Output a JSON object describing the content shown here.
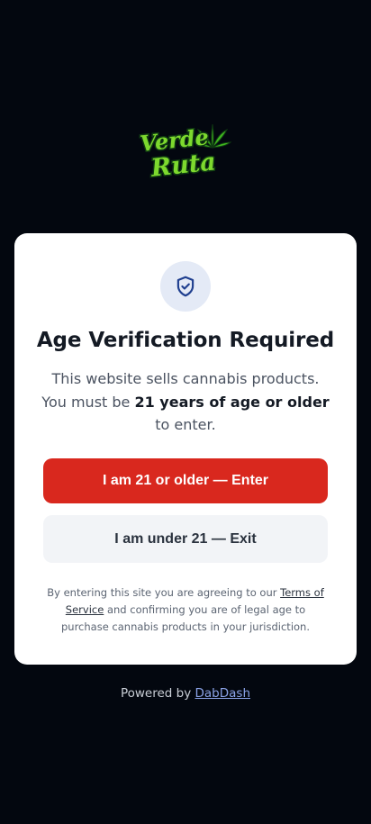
{
  "logo": {
    "line1": "Verde",
    "line2": "Ruta",
    "colors": {
      "leaf": "#3fb51f",
      "text_fill": "#7dd92e",
      "outline": "#0f3a12"
    }
  },
  "card": {
    "icon": "shield-check-icon",
    "title": "Age Verification Required",
    "description_before": "This website sells cannabis products. You must be ",
    "description_bold": "21 years of age or older",
    "description_after": " to enter.",
    "enter_button_label": "I am 21 or older — Enter",
    "exit_button_label": "I am under 21 — Exit",
    "fine_print_before": "By entering this site you are agreeing to our ",
    "fine_print_link": "Terms of Service",
    "fine_print_after": " and confirming you are of legal age to purchase cannabis products in your jurisdiction."
  },
  "footer": {
    "powered_by": "Powered by ",
    "brand_link": "DabDash"
  },
  "colors": {
    "background": "#03070f",
    "accent_red": "#d9281e",
    "link_blue": "#8aa2e6",
    "shield_blue": "#1f3f8f"
  }
}
